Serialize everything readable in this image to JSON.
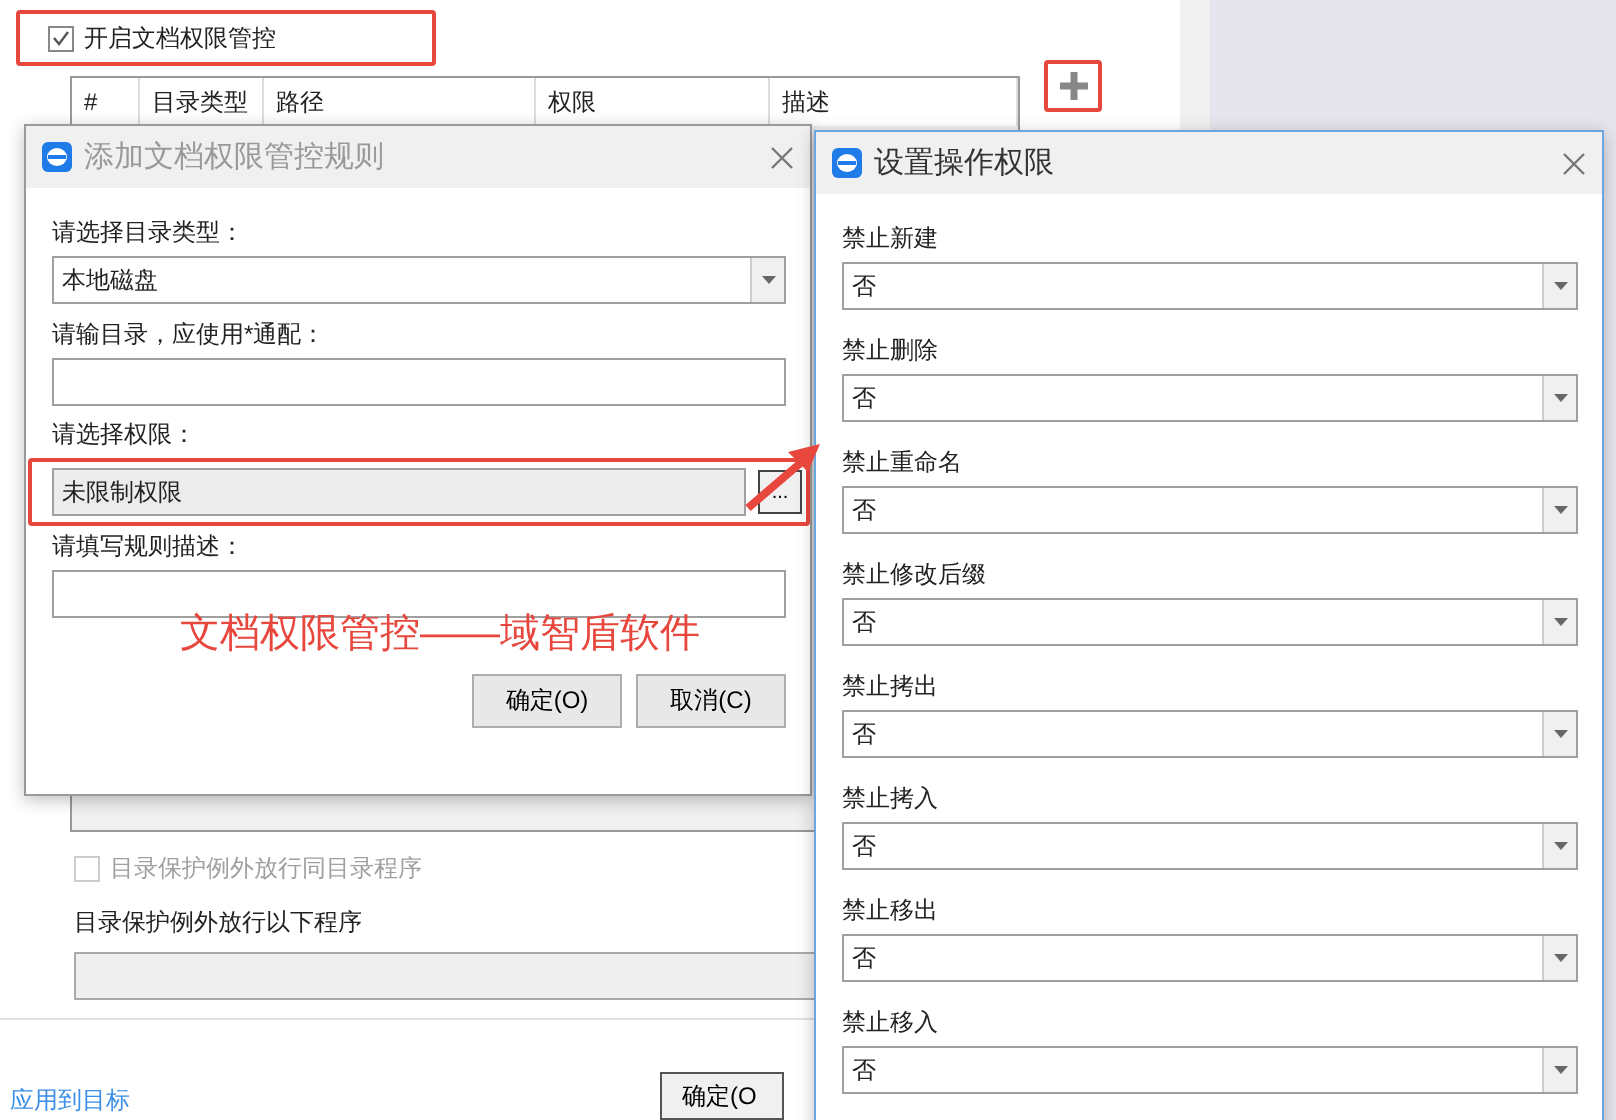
{
  "main": {
    "enable_checkbox": {
      "label": "开启文档权限管控",
      "checked": true
    },
    "table": {
      "columns": [
        "#",
        "目录类型",
        "路径",
        "权限",
        "描述"
      ]
    },
    "exception_checkbox": {
      "label": "目录保护例外放行同目录程序",
      "checked": false,
      "disabled": true
    },
    "exception_label": "目录保护例外放行以下程序",
    "apply_link": "应用到目标",
    "ok_button": "确定(O"
  },
  "rule_dialog": {
    "title": "添加文档权限管控规则",
    "type_label": "请选择目录类型：",
    "type_value": "本地磁盘",
    "dir_label": "请输目录，应使用*通配：",
    "perm_label": "请选择权限：",
    "perm_value": "未限制权限",
    "browse_button": "...",
    "desc_label": "请填写规则描述：",
    "ok_button": "确定(O)",
    "cancel_button": "取消(C)"
  },
  "permission_dialog": {
    "title": "设置操作权限",
    "settings": [
      {
        "label": "禁止新建",
        "value": "否"
      },
      {
        "label": "禁止删除",
        "value": "否"
      },
      {
        "label": "禁止重命名",
        "value": "否"
      },
      {
        "label": "禁止修改后缀",
        "value": "否"
      },
      {
        "label": "禁止拷出",
        "value": "否"
      },
      {
        "label": "禁止拷入",
        "value": "否"
      },
      {
        "label": "禁止移出",
        "value": "否"
      },
      {
        "label": "禁止移入",
        "value": "否"
      }
    ]
  },
  "annotation": "文档权限管控——域智盾软件"
}
